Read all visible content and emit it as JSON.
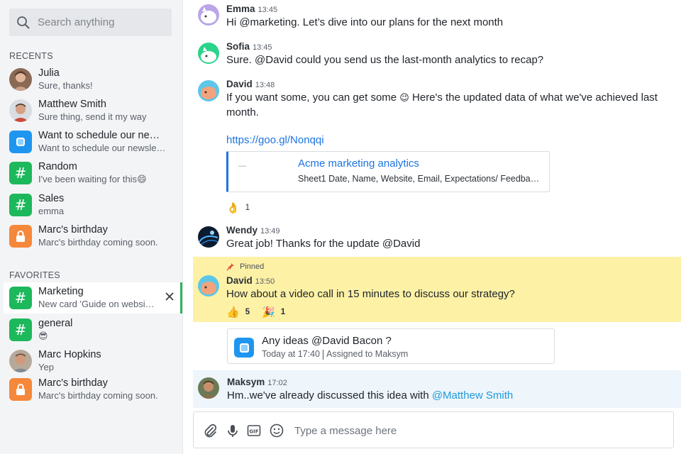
{
  "search": {
    "placeholder": "Search anything"
  },
  "sections": {
    "recents": "RECENTS",
    "favorites": "FAVORITES"
  },
  "recents": [
    {
      "name": "Julia",
      "last": "Sure, thanks!",
      "avatar": "person-avatar"
    },
    {
      "name": "Matthew Smith",
      "last": "Sure thing, send it my way",
      "avatar": "person-avatar"
    },
    {
      "name": "Want to schedule our newsl...",
      "last": "Want to schedule our newslet...",
      "avatar": "task-icon",
      "color": "#1e96f0"
    },
    {
      "name": "Random",
      "last": "I've been waiting for this",
      "emoji": "😄",
      "avatar": "hash-icon",
      "color": "#1db85c"
    },
    {
      "name": "Sales",
      "last": "emma",
      "avatar": "hash-icon",
      "color": "#1db85c"
    },
    {
      "name": "Marc's birthday",
      "last": "Marc's birthday coming soon.",
      "avatar": "lock-icon",
      "color": "#f5883a"
    }
  ],
  "favorites": [
    {
      "name": "Marketing",
      "last": "New card 'Guide on website o...",
      "avatar": "hash-icon",
      "color": "#1db85c",
      "active": true
    },
    {
      "name": "general",
      "last": "😎",
      "avatar": "hash-icon",
      "color": "#1db85c"
    },
    {
      "name": "Marc Hopkins",
      "last": "Yep",
      "avatar": "person-avatar"
    },
    {
      "name": "Marc's birthday",
      "last": "Marc's birthday coming soon.",
      "avatar": "lock-icon",
      "color": "#f5883a"
    }
  ],
  "messages": [
    {
      "author": "Emma",
      "time": "13:45",
      "text": "Hi @marketing. Let’s dive into our plans for the next month"
    },
    {
      "author": "Sofia",
      "time": "13:45",
      "text": "Sure. @David could you send us the last-month analytics to recap?"
    },
    {
      "author": "David",
      "time": "13:48",
      "text_a": "If you want some, you can get some",
      "emoji": "😉",
      "text_b": "Here's the updated data of what we've achieved last month.",
      "link": "https://goo.gl/Nonqqi",
      "preview": {
        "title": "Acme marketing analytics",
        "desc": "Sheet1 Date, Name, Website, Email, Expectations/ Feedback..."
      },
      "reaction": {
        "emoji": "👌",
        "count": "1"
      }
    },
    {
      "author": "Wendy",
      "time": "13:49",
      "text": "Great job! Thanks for the update @David"
    },
    {
      "pinned_label": "Pinned",
      "author": "David",
      "time": "13:50",
      "text": "How about a video call in 15 minutes to discuss our strategy?",
      "reactions": [
        {
          "emoji": "👍",
          "count": "5"
        },
        {
          "emoji": "🎉",
          "count": "1"
        }
      ]
    },
    {
      "author": "Maksym",
      "time": "17:02",
      "text_a": "Hm..we've already discussed this idea with",
      "mention": "@Matthew Smith"
    }
  ],
  "task": {
    "title": "Any ideas @David Bacon ?",
    "when": "Today at 17:40",
    "assigned": "Assigned to  Maksym"
  },
  "composer": {
    "placeholder": "Type a message here"
  },
  "colors": {
    "accent_green": "#2fb457",
    "link_blue": "#1d74e0",
    "pinned_bg": "#fdf1a6"
  }
}
